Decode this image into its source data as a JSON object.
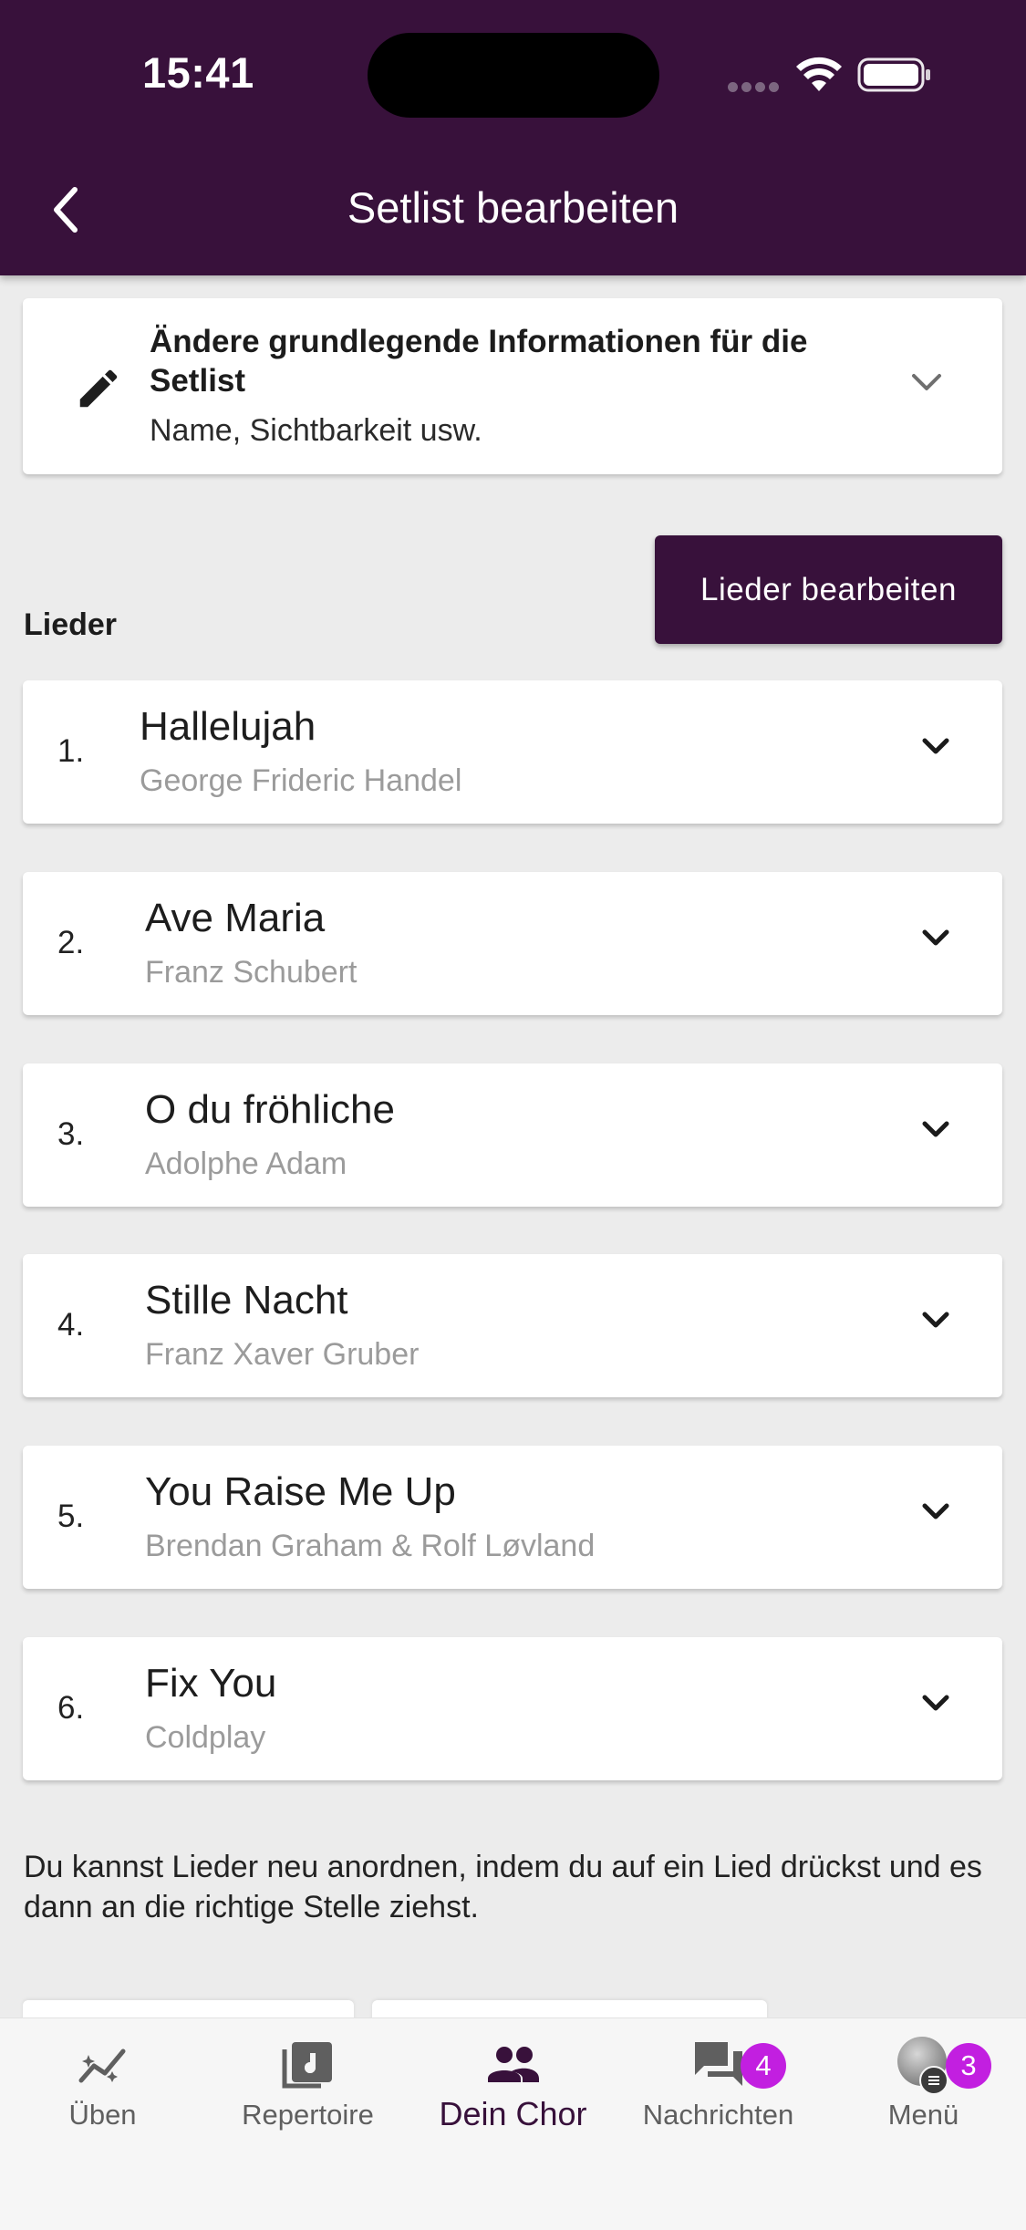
{
  "status_bar": {
    "time": "15:41"
  },
  "header": {
    "title": "Setlist bearbeiten"
  },
  "info_card": {
    "heading": "Ändere grundlegende Informationen für die Setlist",
    "subtitle": "Name, Sichtbarkeit usw."
  },
  "songs_section": {
    "label": "Lieder",
    "edit_button_label": "Lieder bearbeiten",
    "songs": [
      {
        "number": "1.",
        "title": "Hallelujah",
        "artist": "George Frideric Handel"
      },
      {
        "number": "2.",
        "title": "Ave Maria",
        "artist": "Franz Schubert"
      },
      {
        "number": "3.",
        "title": "O du fröhliche",
        "artist": "Adolphe Adam"
      },
      {
        "number": "4.",
        "title": "Stille Nacht",
        "artist": "Franz Xaver Gruber"
      },
      {
        "number": "5.",
        "title": "You Raise Me Up",
        "artist": "Brendan Graham & Rolf Løvland"
      },
      {
        "number": "6.",
        "title": "Fix You",
        "artist": "Coldplay"
      }
    ],
    "hint": "Du kannst Lieder neu anordnen, indem du auf ein Lied drückst und es dann an die richtige Stelle ziehst."
  },
  "bottom_nav": {
    "items": [
      {
        "label": "Üben",
        "icon": "practice-trend-icon"
      },
      {
        "label": "Repertoire",
        "icon": "music-library-icon"
      },
      {
        "label": "Dein Chor",
        "icon": "group-icon",
        "active": true
      },
      {
        "label": "Nachrichten",
        "icon": "chat-icon",
        "badge": "4"
      },
      {
        "label": "Menü",
        "icon": "avatar-menu-icon",
        "badge": "3"
      }
    ]
  },
  "colors": {
    "primary": "#38113b",
    "badge": "#c21fe0",
    "background": "#ececec"
  }
}
